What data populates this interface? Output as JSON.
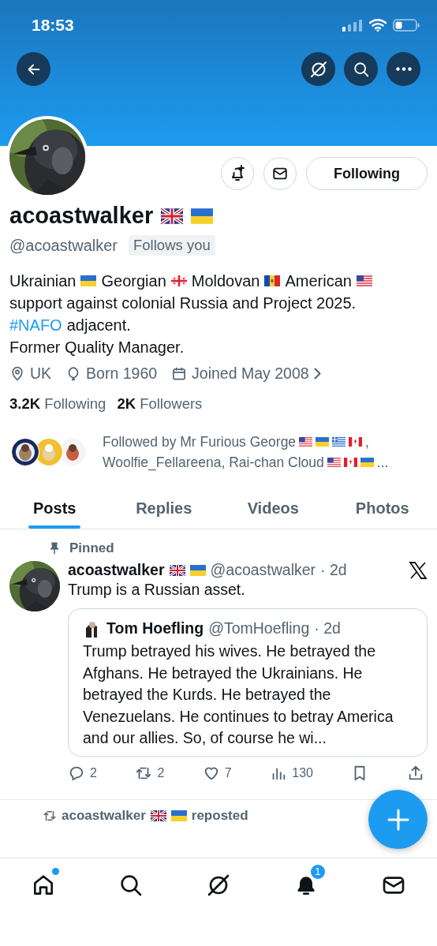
{
  "status_bar": {
    "time": "18:53"
  },
  "profile": {
    "display_name": "acoastwalker",
    "name_flags": [
      {
        "kind": "flag_gb"
      },
      {
        "kind": "flag_ua"
      }
    ],
    "handle": "@acoastwalker",
    "follows_you": "Follows you",
    "follow_button": "Following",
    "bio": [
      [
        {
          "kind": "text",
          "text": "Ukrainian"
        },
        {
          "kind": "flag_ua"
        },
        {
          "kind": "text",
          "text": "Georgian"
        },
        {
          "kind": "flag_ge"
        },
        {
          "kind": "text",
          "text": "Moldovan"
        },
        {
          "kind": "flag_md"
        },
        {
          "kind": "text",
          "text": "American"
        },
        {
          "kind": "flag_us"
        }
      ],
      [
        {
          "kind": "text",
          "text": "support against colonial Russia and Project 2025."
        }
      ],
      [
        {
          "kind": "hashtag",
          "text": "#NAFO"
        },
        {
          "kind": "text",
          "text": "adjacent."
        }
      ],
      [
        {
          "kind": "text",
          "text": "Former Quality Manager."
        }
      ]
    ],
    "meta": [
      {
        "kind": "location",
        "text": "UK"
      },
      {
        "kind": "birthday",
        "text": "Born 1960"
      },
      {
        "kind": "joined",
        "text": "Joined May 2008"
      }
    ],
    "stats": [
      {
        "count": "3.2K",
        "label": "Following"
      },
      {
        "count": "2K",
        "label": "Followers"
      }
    ],
    "followed_by": [
      [
        {
          "kind": "text",
          "text": "Followed by Mr Furious George"
        },
        {
          "kind": "flag_us"
        },
        {
          "kind": "flag_ua"
        },
        {
          "kind": "flag_gr"
        },
        {
          "kind": "flag_ca"
        },
        {
          "kind": "text",
          "text": ","
        }
      ],
      [
        {
          "kind": "text",
          "text": "Woolfie_Fellareena, Rai-chan Cloud"
        },
        {
          "kind": "flag_us"
        },
        {
          "kind": "flag_ca"
        },
        {
          "kind": "flag_ua"
        },
        {
          "kind": "text",
          "text": "..."
        }
      ]
    ]
  },
  "tabs": [
    {
      "label": "Posts",
      "selected": true
    },
    {
      "label": "Replies",
      "selected": false
    },
    {
      "label": "Videos",
      "selected": false
    },
    {
      "label": "Photos",
      "selected": false
    }
  ],
  "pinned_post": {
    "pinned_label": "Pinned",
    "author": "acoastwalker",
    "author_flags": [
      {
        "kind": "flag_gb"
      },
      {
        "kind": "flag_ua"
      }
    ],
    "handle": "@acoastwalker",
    "time": "· 2d",
    "text": "Trump is a Russian asset.",
    "quote": {
      "author": "Tom Hoefling",
      "handle": "@TomHoefling",
      "time": "· 2d",
      "text": "Trump betrayed his wives. He betrayed the Afghans.  He betrayed the Ukrainians. He betrayed the Kurds. He betrayed the Venezuelans. He continues to betray America and our allies. So, of course he wi..."
    },
    "actions": [
      {
        "kind": "reply",
        "count": "2"
      },
      {
        "kind": "repost",
        "count": "2"
      },
      {
        "kind": "like",
        "count": "7"
      },
      {
        "kind": "views",
        "count": "130"
      },
      {
        "kind": "bookmark"
      },
      {
        "kind": "share"
      }
    ]
  },
  "next_post": {
    "user": "acoastwalker",
    "user_flags": [
      {
        "kind": "flag_gb"
      },
      {
        "kind": "flag_ua"
      }
    ],
    "text": "reposted"
  },
  "bottom_nav": [
    {
      "kind": "home",
      "unread": true
    },
    {
      "kind": "search"
    },
    {
      "kind": "grok"
    },
    {
      "kind": "notifications",
      "badge": "1"
    },
    {
      "kind": "messages"
    }
  ]
}
